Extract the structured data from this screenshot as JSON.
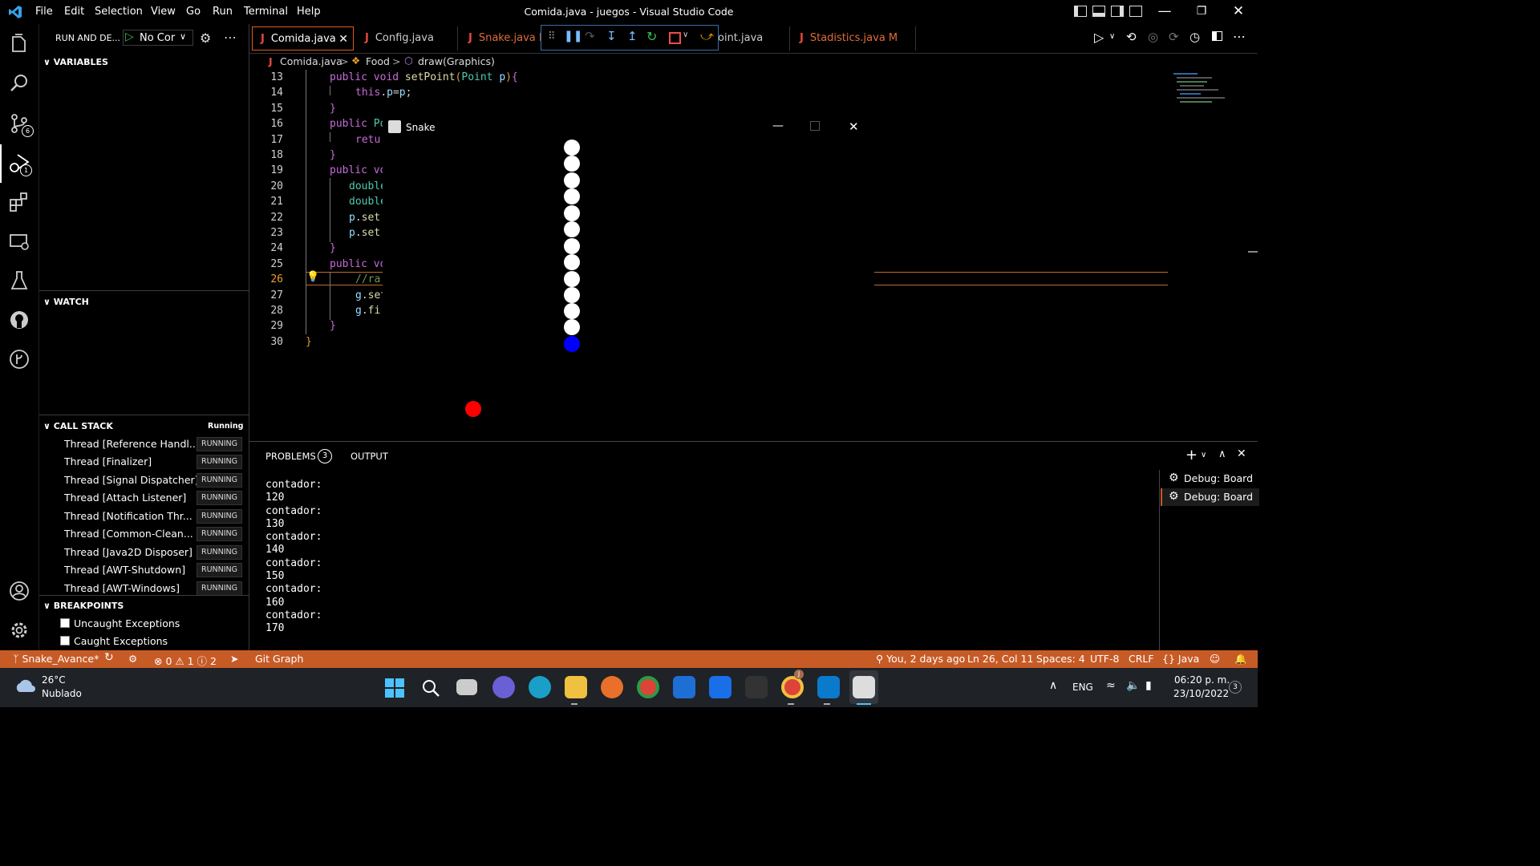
{
  "menu": [
    "File",
    "Edit",
    "Selection",
    "View",
    "Go",
    "Run",
    "Terminal",
    "Help"
  ],
  "window_title": "Comida.java - juegos - Visual Studio Code",
  "sidebar": {
    "header": "RUN AND DE...",
    "config_select": "No Cor",
    "variables": "VARIABLES",
    "watch": "WATCH",
    "call_stack": "CALL STACK",
    "call_stack_state": "Running",
    "threads": [
      {
        "name": "Thread [Reference Handl...",
        "state": "RUNNING"
      },
      {
        "name": "Thread [Finalizer]",
        "state": "RUNNING"
      },
      {
        "name": "Thread [Signal Dispatcher]",
        "state": "RUNNING"
      },
      {
        "name": "Thread [Attach Listener]",
        "state": "RUNNING"
      },
      {
        "name": "Thread [Notification Thr...",
        "state": "RUNNING"
      },
      {
        "name": "Thread [Common-Clean...",
        "state": "RUNNING"
      },
      {
        "name": "Thread [Java2D Disposer]",
        "state": "RUNNING"
      },
      {
        "name": "Thread [AWT-Shutdown]",
        "state": "RUNNING"
      },
      {
        "name": "Thread [AWT-Windows]",
        "state": "RUNNING"
      }
    ],
    "breakpoints": "BREAKPOINTS",
    "bp_items": [
      "Uncaught Exceptions",
      "Caught Exceptions"
    ]
  },
  "activity_badges": {
    "source_control": "6",
    "run_debug": "1"
  },
  "tabs": [
    {
      "label": "Comida.java",
      "active": true
    },
    {
      "label": "Config.java"
    },
    {
      "label": "Snake.java M"
    },
    {
      "label": "oint.java"
    },
    {
      "label": "Stadistics.java M"
    }
  ],
  "breadcrumb": {
    "file": "Comida.java",
    "class": "Food",
    "method": "draw(Graphics)"
  },
  "code_lines": [
    {
      "n": "13",
      "parts": [
        [
          "kw",
          "public void "
        ],
        [
          "fn",
          "setPoint"
        ],
        [
          "br",
          "("
        ],
        [
          "ty",
          "Point "
        ],
        [
          "pa",
          "p"
        ],
        [
          "br",
          ")"
        ],
        [
          "kw",
          "{"
        ]
      ]
    },
    {
      "n": "14",
      "parts": [
        [
          "kw",
          "this"
        ],
        [
          "op",
          "."
        ],
        [
          "pa",
          "p"
        ],
        [
          "op",
          "="
        ],
        [
          "pa",
          "p"
        ],
        [
          "op",
          ";"
        ]
      ]
    },
    {
      "n": "15",
      "parts": [
        [
          "kw",
          "}"
        ]
      ]
    },
    {
      "n": "16",
      "parts": [
        [
          "kw",
          "public "
        ],
        [
          "ty",
          "Po"
        ]
      ]
    },
    {
      "n": "17",
      "parts": [
        [
          "kw",
          "retu"
        ]
      ]
    },
    {
      "n": "18",
      "parts": [
        [
          "kw",
          "}"
        ]
      ]
    },
    {
      "n": "19",
      "parts": [
        [
          "kw",
          "public "
        ],
        [
          "kw",
          "vo"
        ]
      ]
    },
    {
      "n": "20",
      "parts": [
        [
          "ty",
          "double"
        ]
      ]
    },
    {
      "n": "21",
      "parts": [
        [
          "ty",
          "double"
        ]
      ]
    },
    {
      "n": "22",
      "parts": [
        [
          "pa",
          "p"
        ],
        [
          "op",
          "."
        ],
        [
          "fn",
          "set"
        ]
      ]
    },
    {
      "n": "23",
      "parts": [
        [
          "pa",
          "p"
        ],
        [
          "op",
          "."
        ],
        [
          "fn",
          "set"
        ]
      ]
    },
    {
      "n": "24",
      "parts": [
        [
          "kw",
          "}"
        ]
      ]
    },
    {
      "n": "25",
      "parts": [
        [
          "kw",
          "public "
        ],
        [
          "kw",
          "vo"
        ]
      ]
    },
    {
      "n": "26",
      "parts": [
        [
          "cm",
          "//ra"
        ]
      ]
    },
    {
      "n": "27",
      "parts": [
        [
          "pa",
          "g"
        ],
        [
          "op",
          "."
        ],
        [
          "fn",
          "set"
        ]
      ]
    },
    {
      "n": "28",
      "parts": [
        [
          "pa",
          "g"
        ],
        [
          "op",
          "."
        ],
        [
          "fn",
          "fi"
        ]
      ]
    },
    {
      "n": "29",
      "parts": [
        [
          "kw",
          "}"
        ]
      ]
    },
    {
      "n": "30",
      "parts": [
        [
          "br",
          "}"
        ]
      ]
    }
  ],
  "snake_window": {
    "title": "Snake"
  },
  "panel": {
    "tab_problems": "PROBLEMS",
    "problems_count": "3",
    "tab_output": "OUTPUT",
    "terminal_lines": [
      "contador:",
      "120",
      "contador:",
      "130",
      "contador:",
      "140",
      "contador:",
      "150",
      "contador:",
      "160",
      "contador:",
      "170"
    ],
    "terminals": [
      "Debug: Board",
      "Debug: Board"
    ]
  },
  "status": {
    "branch": "Snake_Avance*",
    "errors": "0",
    "warnings": "1",
    "infos": "2",
    "git_graph": "Git Graph",
    "blame": "You, 2 days ago",
    "position": "Ln 26, Col 11",
    "spaces": "Spaces: 4",
    "encoding": "UTF-8",
    "eol": "CRLF",
    "language": "Java"
  },
  "taskbar": {
    "temp": "26°C",
    "weather": "Nublado",
    "lang": "ENG",
    "time": "06:20 p. m.",
    "date": "23/10/2022",
    "notif": "3",
    "chrome_badge": "J"
  }
}
